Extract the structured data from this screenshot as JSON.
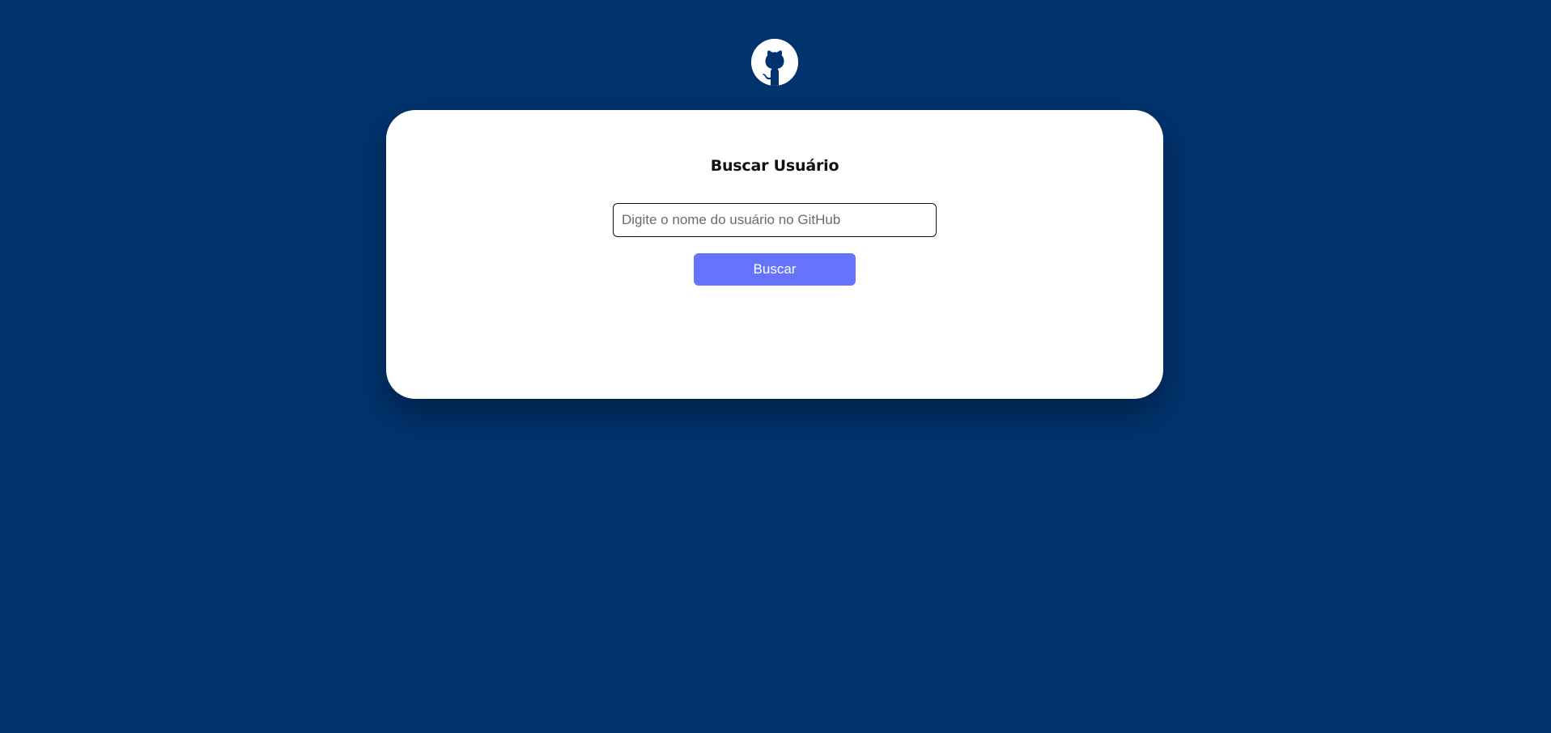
{
  "logo": {
    "icon": "github-icon",
    "background_color": "#ffffff",
    "mark_color": "#00336d"
  },
  "page": {
    "background_color": "#00336d"
  },
  "search_card": {
    "title": "Buscar Usuário",
    "input": {
      "value": "",
      "placeholder": "Digite o nome do usuário no GitHub"
    },
    "button": {
      "label": "Buscar",
      "color": "#6673fd"
    }
  }
}
